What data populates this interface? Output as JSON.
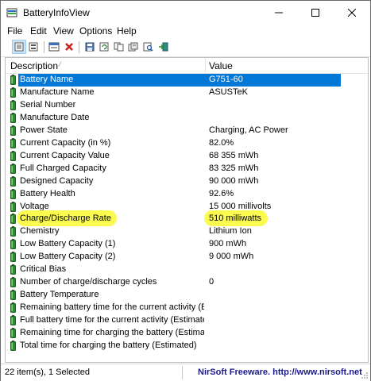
{
  "window": {
    "title": "BatteryInfoView"
  },
  "menu": [
    "File",
    "Edit",
    "View",
    "Options",
    "Help"
  ],
  "columns": {
    "description": "Description",
    "value": "Value"
  },
  "rows": [
    {
      "description": "Battery Name",
      "value": "G751-60",
      "selected": true
    },
    {
      "description": "Manufacture Name",
      "value": "ASUSTeK"
    },
    {
      "description": "Serial Number",
      "value": ""
    },
    {
      "description": "Manufacture Date",
      "value": ""
    },
    {
      "description": "Power State",
      "value": "Charging, AC Power"
    },
    {
      "description": "Current Capacity (in %)",
      "value": "82.0%"
    },
    {
      "description": "Current Capacity Value",
      "value": "68 355 mWh"
    },
    {
      "description": "Full Charged Capacity",
      "value": "83 325 mWh"
    },
    {
      "description": "Designed Capacity",
      "value": "90 000 mWh"
    },
    {
      "description": "Battery Health",
      "value": "92.6%"
    },
    {
      "description": "Voltage",
      "value": "15 000 millivolts"
    },
    {
      "description": "Charge/Discharge Rate",
      "value": "510 milliwatts",
      "highlighted": true
    },
    {
      "description": "Chemistry",
      "value": "Lithium Ion"
    },
    {
      "description": "Low Battery Capacity (1)",
      "value": "900 mWh"
    },
    {
      "description": "Low Battery Capacity (2)",
      "value": "9 000 mWh"
    },
    {
      "description": "Critical Bias",
      "value": ""
    },
    {
      "description": "Number of charge/discharge cycles",
      "value": "0"
    },
    {
      "description": "Battery Temperature",
      "value": ""
    },
    {
      "description": "Remaining battery time for the current activity (Est...",
      "value": ""
    },
    {
      "description": "Full battery time for the current activity (Estimated)",
      "value": ""
    },
    {
      "description": "Remaining time for charging the battery (Estimated)",
      "value": ""
    },
    {
      "description": "Total  time for charging the battery (Estimated)",
      "value": ""
    }
  ],
  "status": {
    "items": "22 item(s), 1 Selected",
    "credit": "NirSoft Freeware.  http://www.nirsoft.net"
  },
  "colors": {
    "selection": "#0078d7",
    "highlight": "#fbfb3c",
    "battery": "#2e8b2e"
  }
}
